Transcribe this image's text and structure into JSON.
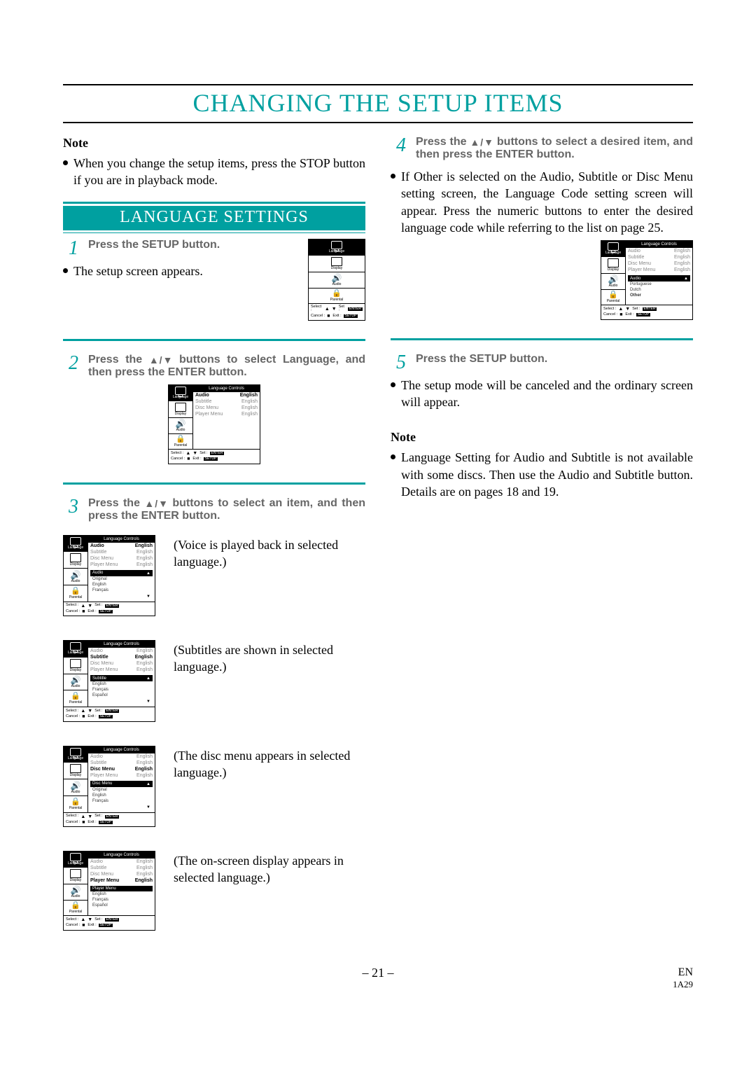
{
  "title": "CHANGING THE SETUP ITEMS",
  "left": {
    "note_label": "Note",
    "note_text": "When you change the setup items, press the STOP button if you are in playback mode.",
    "section_title": "LANGUAGE SETTINGS",
    "step1_num": "1",
    "step1_text": "Press the SETUP button.",
    "step1_after": "The setup screen appears.",
    "step2_num": "2",
    "step2_text_a": "Press the ",
    "step2_text_b": " buttons to select Language, and then press the ENTER button.",
    "step3_num": "3",
    "step3_text_a": "Press the ",
    "step3_text_b": " buttons to select an item, and then press the ENTER button.",
    "desc_audio": "(Voice is played back in selected language.)",
    "desc_subtitle": "(Subtitles are shown in selected language.)",
    "desc_discmenu": "(The disc menu appears in selected language.)",
    "desc_playermenu": "(The on-screen display appears in selected language.)"
  },
  "right": {
    "step4_num": "4",
    "step4_text_a": "Press the ",
    "step4_text_b": " buttons to select a desired item, and then press the ENTER button.",
    "step4_after": "If Other is selected on the Audio, Subtitle or Disc Menu setting screen, the Language Code setting screen will appear. Press the numeric buttons to enter the desired language code while referring to the list on page 25.",
    "step5_num": "5",
    "step5_text": "Press the SETUP button.",
    "step5_after": "The setup mode will be canceled and the ordinary screen will appear.",
    "note_label": "Note",
    "note_text": "Language Setting for Audio and Subtitle is not available with some discs. Then use the Audio and Subtitle button. Details are on pages 18 and 19."
  },
  "mini": {
    "title": "Language Controls",
    "side": {
      "language": "Language",
      "display": "Display",
      "audio": "Audio",
      "parental": "Parental"
    },
    "rows": {
      "audio": "Audio",
      "subtitle": "Subtitle",
      "discmenu": "Disc Menu",
      "playermenu": "Player Menu",
      "english": "English"
    },
    "sub": {
      "audio": "Audio",
      "subtitle": "Subtitle",
      "discmenu": "Disc Menu",
      "playermenu": "Player Menu",
      "original": "Original",
      "english": "English",
      "french": "Français",
      "spanish": "Español",
      "portuguese": "Portuguese",
      "dutch": "Dutch",
      "other": "Other"
    },
    "footer": {
      "select": "Select :",
      "set": "Set :",
      "cancel": "Cancel :",
      "exit": "Exit :",
      "enter": "ENTER",
      "setup": "SETUP"
    }
  },
  "footer": {
    "page": "– 21 –",
    "en": "EN",
    "code": "1A29"
  }
}
